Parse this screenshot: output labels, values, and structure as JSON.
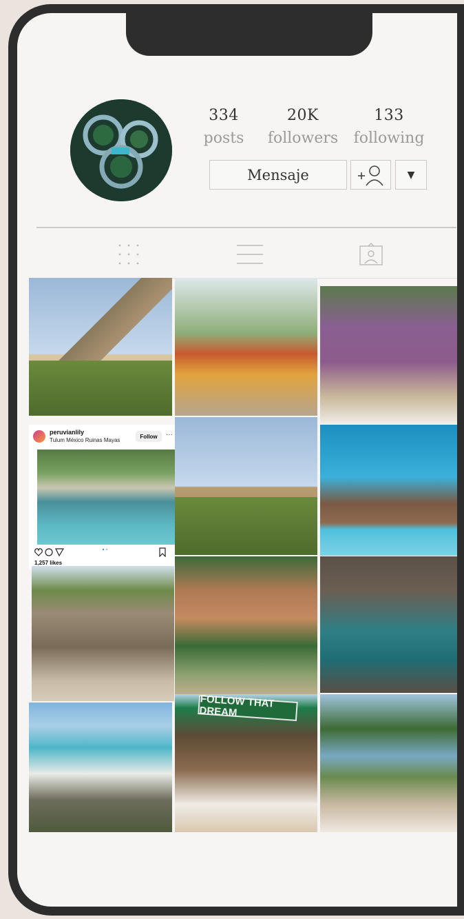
{
  "profile": {
    "stats": [
      {
        "value": "334",
        "label": "posts"
      },
      {
        "value": "20K",
        "label": "followers"
      },
      {
        "value": "133",
        "label": "following"
      }
    ],
    "message_label": "Mensaje",
    "more_label": "▼"
  },
  "tabs": [
    "grid-icon",
    "list-icon",
    "tagged-icon"
  ],
  "grid": [
    {
      "name": "photo-chichen-itza-pyramid"
    },
    {
      "name": "photo-tulum-signs"
    },
    {
      "name": "photo-purple-sculpture"
    },
    {
      "name": "photo-cenote-post"
    },
    {
      "name": "photo-chichen-itza-pyramid-2"
    },
    {
      "name": "photo-dock-turquoise-water"
    },
    {
      "name": "photo-coba-ruins"
    },
    {
      "name": "photo-wooden-statue"
    },
    {
      "name": "photo-cave-cenote"
    },
    {
      "name": "photo-tulum-beach"
    },
    {
      "name": "photo-follow-that-dream"
    },
    {
      "name": "photo-yoga-headstand"
    }
  ],
  "embedded_post": {
    "username": "peruvianlily",
    "location": "Tulum México Ruinas Mayas",
    "follow_label": "Follow",
    "more": "···",
    "likes": "1,257 likes"
  },
  "sign_text": "FOLLOW THAT DREAM",
  "colors": {
    "phone_frame": "#2d2d2d",
    "screen_bg": "#f6f5f3",
    "page_bg": "#ebe4de",
    "stat_label": "#9a9a9a"
  }
}
